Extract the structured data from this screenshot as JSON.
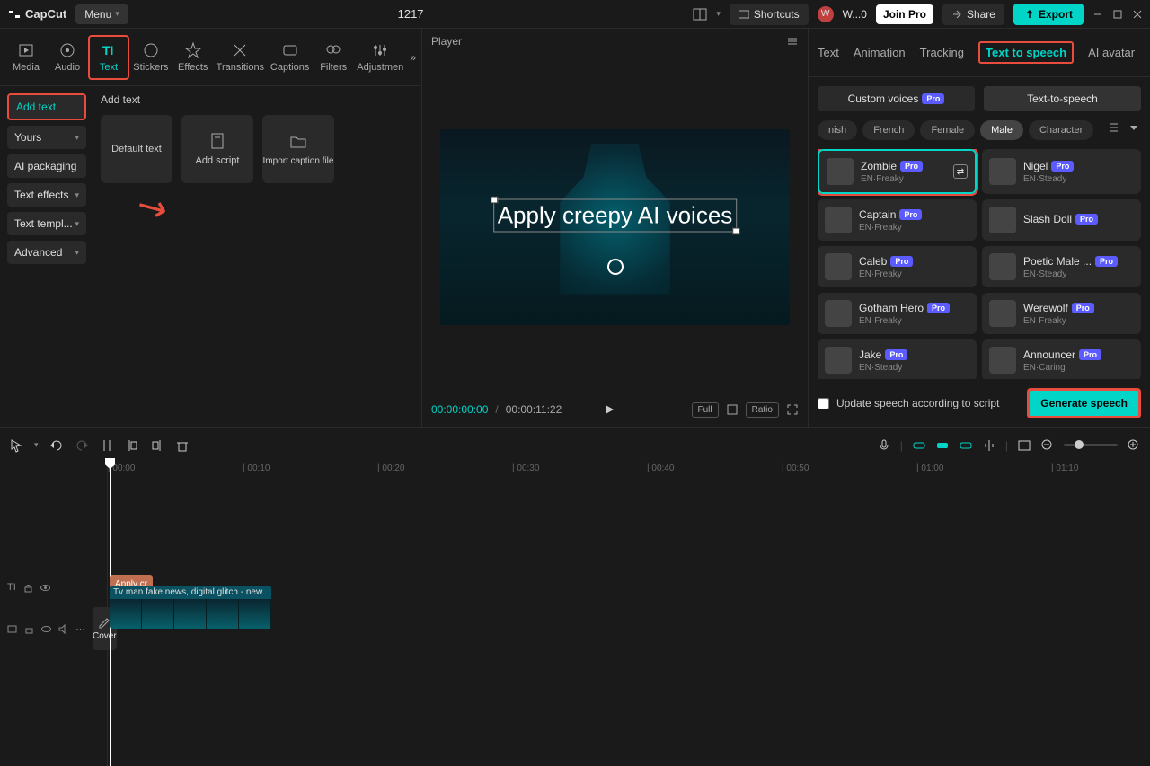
{
  "titlebar": {
    "logo": "CapCut",
    "menu": "Menu",
    "project": "1217",
    "shortcuts": "Shortcuts",
    "user": "W...0",
    "joinpro": "Join Pro",
    "share": "Share",
    "export": "Export"
  },
  "tools": [
    "Media",
    "Audio",
    "Text",
    "Stickers",
    "Effects",
    "Transitions",
    "Captions",
    "Filters",
    "Adjustmen"
  ],
  "text_sidebar": [
    "Add text",
    "Yours",
    "AI packaging",
    "Text effects",
    "Text templ...",
    "Advanced"
  ],
  "text_header": "Add text",
  "text_cards": [
    "Default text",
    "Add script",
    "Import caption file"
  ],
  "player": {
    "label": "Player",
    "overlay_text": "Apply creepy AI voices",
    "time_current": "00:00:00:00",
    "time_total": "00:00:11:22",
    "full": "Full",
    "ratio": "Ratio"
  },
  "right_tabs": [
    "Text",
    "Animation",
    "Tracking",
    "Text to speech",
    "AI avatar"
  ],
  "sub_tabs": {
    "custom": "Custom voices",
    "tts": "Text-to-speech"
  },
  "filters": [
    "nish",
    "French",
    "Female",
    "Male",
    "Character"
  ],
  "voices": [
    {
      "name": "Zombie",
      "sub": "EN·Freaky",
      "pro": true,
      "selected": true
    },
    {
      "name": "Nigel",
      "sub": "EN·Steady",
      "pro": true
    },
    {
      "name": "Captain",
      "sub": "EN·Freaky",
      "pro": true
    },
    {
      "name": "Slash Doll",
      "sub": "",
      "pro": true
    },
    {
      "name": "Caleb",
      "sub": "EN·Freaky",
      "pro": true
    },
    {
      "name": "Poetic Male ...",
      "sub": "EN·Steady",
      "pro": true
    },
    {
      "name": "Gotham Hero",
      "sub": "EN·Freaky",
      "pro": true
    },
    {
      "name": "Werewolf",
      "sub": "EN·Freaky",
      "pro": true
    },
    {
      "name": "Jake",
      "sub": "EN·Steady",
      "pro": true
    },
    {
      "name": "Announcer",
      "sub": "EN·Caring",
      "pro": true
    }
  ],
  "update_speech": "Update speech according to script",
  "generate": "Generate speech",
  "ruler": [
    "00:00",
    "00:10",
    "00:20",
    "00:30",
    "00:40",
    "00:50",
    "01:00",
    "01:10"
  ],
  "text_clip": "Apply cr",
  "video_clip": "Tv man fake news, digital glitch - new",
  "cover": "Cover"
}
